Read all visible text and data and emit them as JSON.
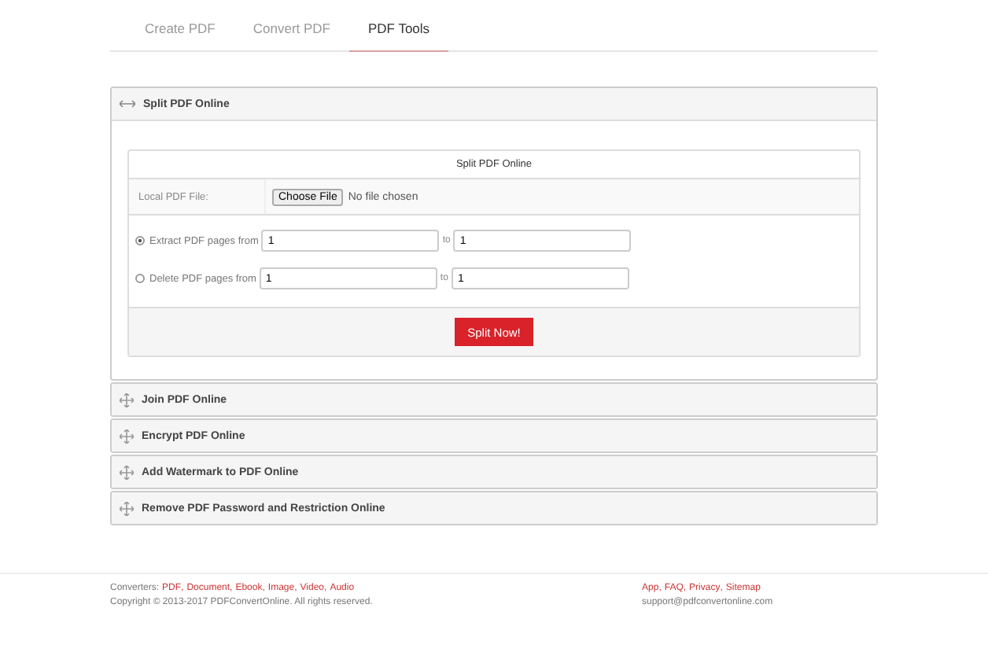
{
  "tabs": [
    {
      "label": "Create PDF",
      "selected": false
    },
    {
      "label": "Convert PDF",
      "selected": false
    },
    {
      "label": "PDF Tools",
      "selected": true
    }
  ],
  "panels": [
    {
      "title": "Split PDF Online",
      "expanded": true
    },
    {
      "title": "Join PDF Online",
      "expanded": false
    },
    {
      "title": "Encrypt PDF Online",
      "expanded": false
    },
    {
      "title": "Add Watermark to PDF Online",
      "expanded": false
    },
    {
      "title": "Remove PDF Password and Restriction Online",
      "expanded": false
    }
  ],
  "split_form": {
    "title": "Split PDF Online",
    "file_label": "Local PDF File:",
    "file_button": "Choose File",
    "file_status": "No file chosen",
    "options": [
      {
        "label": "Extract PDF pages from",
        "selected": true,
        "from": "1",
        "to_label": "to",
        "to": "1"
      },
      {
        "label": "Delete PDF pages from",
        "selected": false,
        "from": "1",
        "to_label": "to",
        "to": "1"
      }
    ],
    "submit": "Split Now!"
  },
  "footer": {
    "converters_label": "Converters:",
    "converter_links": [
      {
        "text": "PDF",
        "sep": ","
      },
      {
        "text": "Document",
        "sep": ","
      },
      {
        "text": "Ebook",
        "sep": ","
      },
      {
        "text": "Image",
        "sep": ","
      },
      {
        "text": "Video",
        "sep": ","
      },
      {
        "text": "Audio"
      }
    ],
    "copyright": "Copyright © 2013-2017 PDFConvertOnline. All rights reserved.",
    "links": [
      {
        "text": "App",
        "sep": ","
      },
      {
        "text": "FAQ",
        "sep": ","
      },
      {
        "text": "Privacy",
        "sep": ","
      },
      {
        "text": "Sitemap"
      }
    ],
    "email": "support@pdfconvertonline.com"
  }
}
